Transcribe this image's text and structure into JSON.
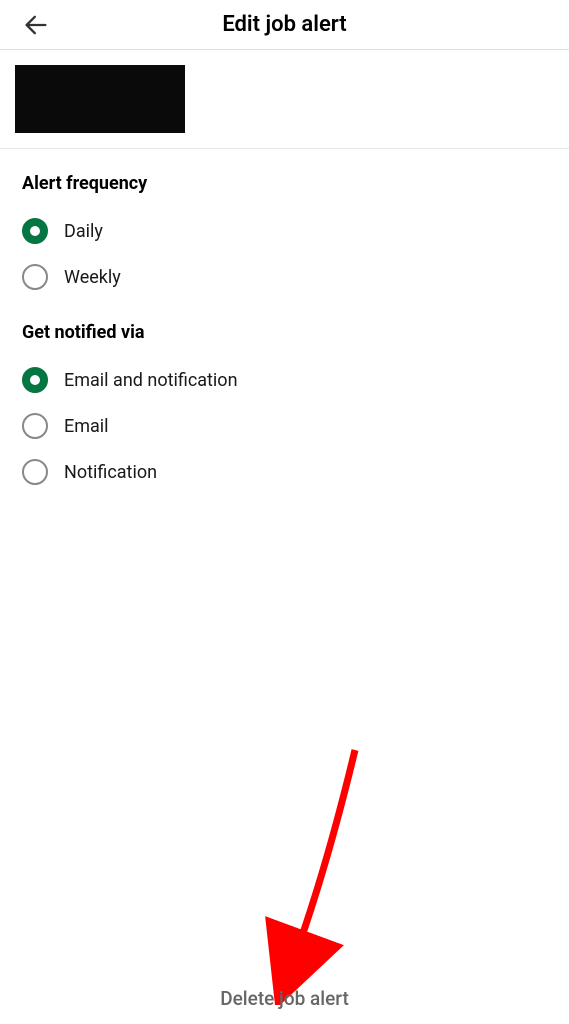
{
  "header": {
    "title": "Edit job alert"
  },
  "sections": {
    "frequency": {
      "title": "Alert frequency",
      "options": {
        "daily": "Daily",
        "weekly": "Weekly"
      }
    },
    "notify": {
      "title": "Get notified via",
      "options": {
        "both": "Email and notification",
        "email": "Email",
        "notification": "Notification"
      }
    }
  },
  "footer": {
    "delete": "Delete job alert"
  }
}
